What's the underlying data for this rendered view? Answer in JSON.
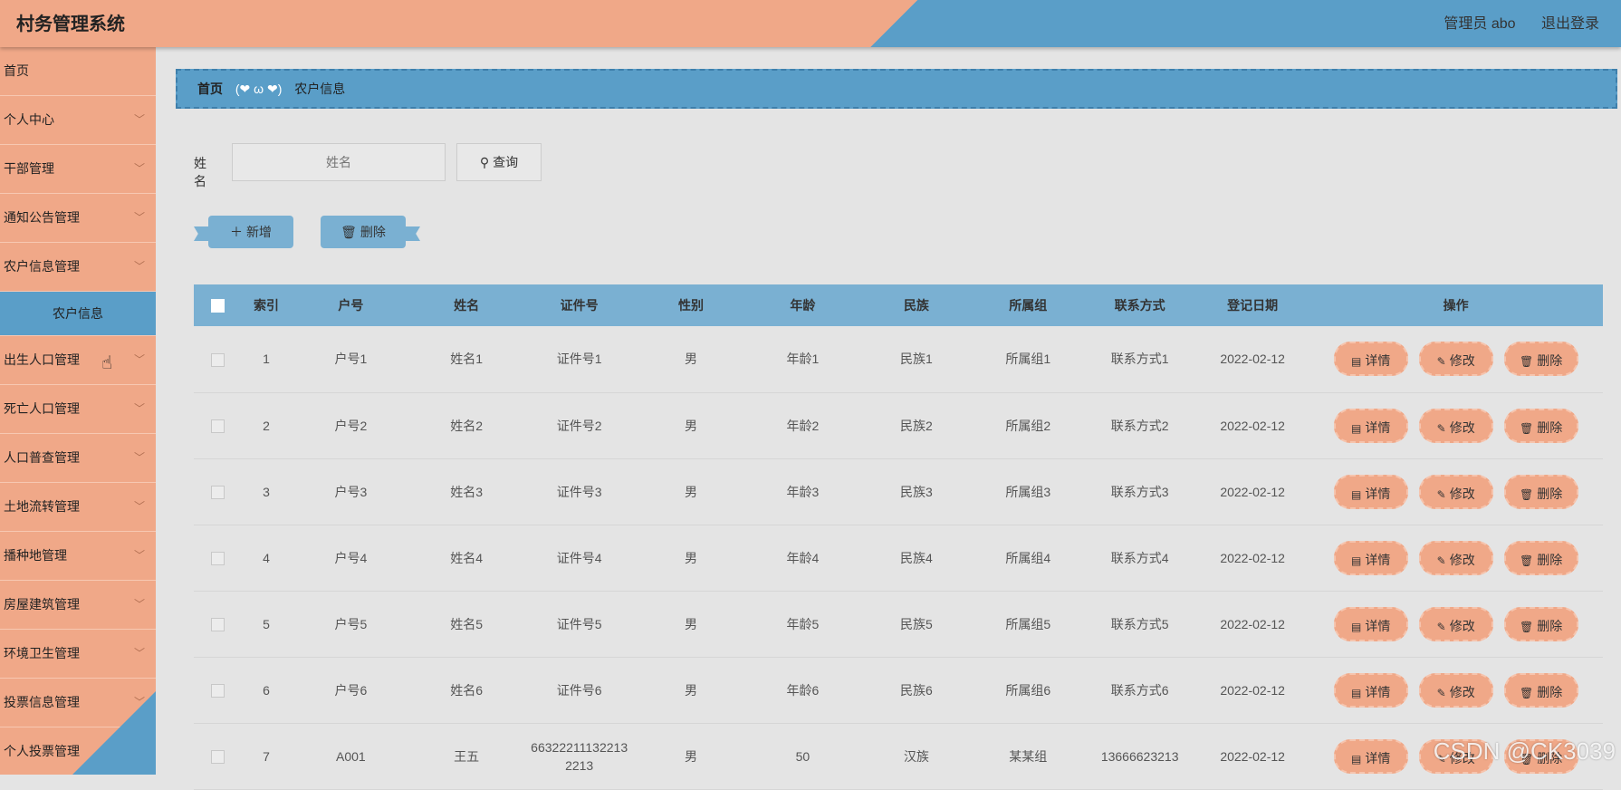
{
  "app": {
    "title": "村务管理系统"
  },
  "header": {
    "user": "管理员 abo",
    "logout": "退出登录"
  },
  "sidebar": {
    "items": [
      {
        "label": "首页",
        "chevron": false
      },
      {
        "label": "个人中心",
        "chevron": true
      },
      {
        "label": "干部管理",
        "chevron": true
      },
      {
        "label": "通知公告管理",
        "chevron": true
      },
      {
        "label": "农户信息管理",
        "chevron": true
      },
      {
        "label": "农户信息",
        "sub": true
      },
      {
        "label": "出生人口管理",
        "chevron": true
      },
      {
        "label": "死亡人口管理",
        "chevron": true
      },
      {
        "label": "人口普查管理",
        "chevron": true
      },
      {
        "label": "土地流转管理",
        "chevron": true
      },
      {
        "label": "播种地管理",
        "chevron": true
      },
      {
        "label": "房屋建筑管理",
        "chevron": true
      },
      {
        "label": "环境卫生管理",
        "chevron": true
      },
      {
        "label": "投票信息管理",
        "chevron": true
      },
      {
        "label": "个人投票管理",
        "chevron": true
      }
    ]
  },
  "breadcrumb": {
    "home": "首页",
    "separator": "(❤ ω ❤)",
    "current": "农户信息"
  },
  "search": {
    "label": "姓名",
    "placeholder": "姓名",
    "button": "查询"
  },
  "actions": {
    "add": "新增",
    "delete": "删除"
  },
  "table": {
    "columns": [
      "索引",
      "户号",
      "姓名",
      "证件号",
      "性别",
      "年龄",
      "民族",
      "所属组",
      "联系方式",
      "登记日期",
      "操作"
    ],
    "ops": {
      "detail": "详情",
      "edit": "修改",
      "delete": "删除"
    },
    "rows": [
      [
        "1",
        "户号1",
        "姓名1",
        "证件号1",
        "男",
        "年龄1",
        "民族1",
        "所属组1",
        "联系方式1",
        "2022-02-12"
      ],
      [
        "2",
        "户号2",
        "姓名2",
        "证件号2",
        "男",
        "年龄2",
        "民族2",
        "所属组2",
        "联系方式2",
        "2022-02-12"
      ],
      [
        "3",
        "户号3",
        "姓名3",
        "证件号3",
        "男",
        "年龄3",
        "民族3",
        "所属组3",
        "联系方式3",
        "2022-02-12"
      ],
      [
        "4",
        "户号4",
        "姓名4",
        "证件号4",
        "男",
        "年龄4",
        "民族4",
        "所属组4",
        "联系方式4",
        "2022-02-12"
      ],
      [
        "5",
        "户号5",
        "姓名5",
        "证件号5",
        "男",
        "年龄5",
        "民族5",
        "所属组5",
        "联系方式5",
        "2022-02-12"
      ],
      [
        "6",
        "户号6",
        "姓名6",
        "证件号6",
        "男",
        "年龄6",
        "民族6",
        "所属组6",
        "联系方式6",
        "2022-02-12"
      ],
      [
        "7",
        "A001",
        "王五",
        "663222111322132213",
        "男",
        "50",
        "汉族",
        "某某组",
        "13666623213",
        "2022-02-12"
      ]
    ]
  },
  "watermark": "CSDN @CK3039",
  "colors": {
    "primary": "#f0a888",
    "secondary": "#5a9ec8",
    "table_header": "#7ab0d2"
  }
}
